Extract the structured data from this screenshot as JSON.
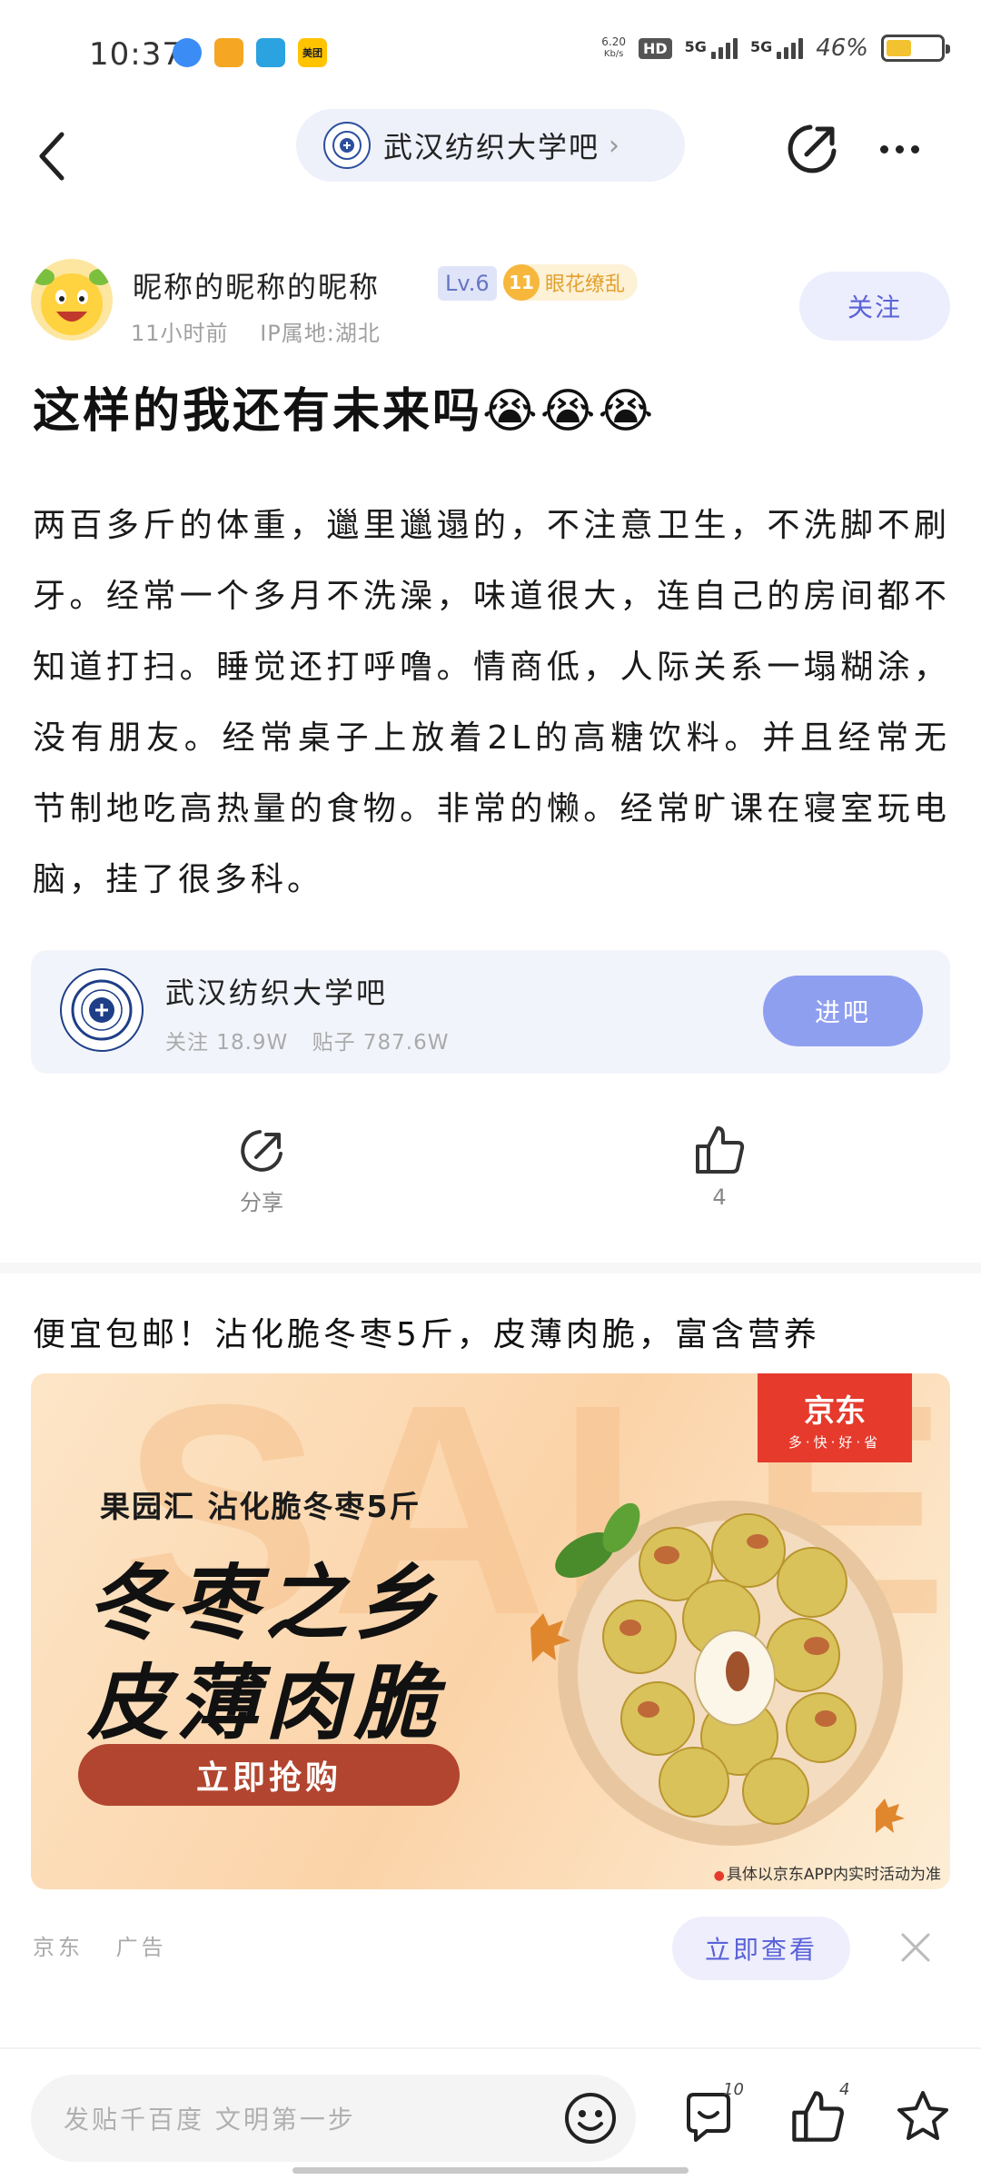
{
  "status_bar": {
    "time": "10:37",
    "net_speed_value": "6.20",
    "net_speed_unit": "Kb/s",
    "hd_label": "HD",
    "sim1_label": "5G",
    "sim2_label": "5G",
    "battery_percent": "46%",
    "battery_level": 0.46,
    "notification_apps": [
      "qq-browser-icon",
      "kuaishou-icon",
      "telegram-icon",
      "meituan-icon"
    ],
    "meituan_label": "美团"
  },
  "nav": {
    "forum_name": "武汉纺织大学吧"
  },
  "author": {
    "name": "昵称的昵称的昵称",
    "level": "Lv.6",
    "rank_number": "11",
    "rank_title": "眼花缭乱",
    "time_ago": "11小时前",
    "ip_location": "IP属地:湖北",
    "follow_label": "关注"
  },
  "post": {
    "title": "这样的我还有未来吗😭😭😭",
    "body": "两百多斤的体重，邋里邋遢的，不注意卫生，不洗脚不刷牙。经常一个多月不洗澡，味道很大，连自己的房间都不知道打扫。睡觉还打呼噜。情商低，人际关系一塌糊涂，没有朋友。经常桌子上放着2L的高糖饮料。并且经常无节制地吃高热量的食物。非常的懒。经常旷课在寝室玩电脑，挂了很多科。"
  },
  "forum_card": {
    "name": "武汉纺织大学吧",
    "followers": "关注 18.9W",
    "posts": "贴子 787.6W",
    "enter_label": "进吧"
  },
  "actions": {
    "share_label": "分享",
    "like_count": "4"
  },
  "ad": {
    "title": "便宜包邮！沾化脆冬枣5斤，皮薄肉脆，富含营养",
    "banner_bg_text": "SALE",
    "brand_name": "京东",
    "brand_slogan": "多·快·好·省",
    "subhead": "果园汇  沾化脆冬枣5斤",
    "headline_1": "冬枣之乡",
    "headline_2": "皮薄肉脆",
    "cta_label": "立即抢购",
    "disclaimer": "具体以京东APP内实时活动为准",
    "source": "京东",
    "ad_tag": "广告",
    "view_label": "立即查看"
  },
  "bottom_bar": {
    "comment_placeholder": "发贴千百度 文明第一步",
    "comment_count": "10",
    "like_count": "4"
  },
  "colors": {
    "accent": "#5a62d8",
    "enter_button": "#8f9ff0",
    "jd_red": "#e53a2c",
    "cta_red": "#b2452f"
  }
}
